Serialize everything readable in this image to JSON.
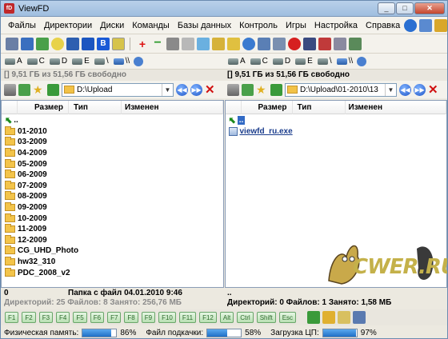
{
  "window": {
    "title": "ViewFD",
    "app_icon_text": "fD"
  },
  "menu": [
    "Файлы",
    "Директории",
    "Диски",
    "Команды",
    "Базы данных",
    "Контроль",
    "Игры",
    "Настройка",
    "Справка"
  ],
  "drives": {
    "left": [
      {
        "label": "A",
        "net": false
      },
      {
        "label": "C",
        "net": false
      },
      {
        "label": "D",
        "net": false
      },
      {
        "label": "E",
        "net": false
      },
      {
        "label": "\\",
        "net": false
      },
      {
        "label": "\\\\",
        "net": true
      }
    ],
    "right": [
      {
        "label": "A",
        "net": false
      },
      {
        "label": "C",
        "net": false
      },
      {
        "label": "D",
        "net": false
      },
      {
        "label": "E",
        "net": false
      },
      {
        "label": "\\",
        "net": false
      },
      {
        "label": "\\\\",
        "net": true
      }
    ]
  },
  "left_panel": {
    "free_space": "[] 9,51 ГБ из 51,56 ГБ свободно",
    "path": "D:\\Upload",
    "columns": {
      "size": "Размер",
      "type": "Тип",
      "modified": "Изменен"
    },
    "up_label": "..",
    "folders": [
      "01-2010",
      "03-2009",
      "04-2009",
      "05-2009",
      "06-2009",
      "07-2009",
      "08-2009",
      "09-2009",
      "10-2009",
      "11-2009",
      "12-2009",
      "CG_UHD_Photo",
      "hw32_310",
      "PDC_2008_v2"
    ],
    "status_left": "0",
    "status_info": "Папка с файл  04.01.2010 9:46",
    "status_summary": "Директорий: 25   Файлов: 8   Занято: 256,76 МБ"
  },
  "right_panel": {
    "free_space": "[] 9,51 ГБ из 51,56 ГБ свободно",
    "path": "D:\\Upload\\01-2010\\13",
    "columns": {
      "size": "Размер",
      "type": "Тип",
      "modified": "Изменен"
    },
    "up_label": "..",
    "file": "viewfd_ru.exe",
    "status_left": "..",
    "status_summary": "Директорий: 0   Файлов: 1   Занято: 1,58 МБ"
  },
  "fkeys": [
    "F1",
    "F2",
    "F3",
    "F4",
    "F5",
    "F6",
    "F7",
    "F8",
    "F9",
    "F10",
    "F11",
    "F12",
    "Alt",
    "Ctrl",
    "Shift",
    "Esc"
  ],
  "meters": [
    {
      "label": "Физическая память:",
      "value": "86%",
      "fraction": 0.86
    },
    {
      "label": "Файл подкачки:",
      "value": "58%",
      "fraction": 0.58
    },
    {
      "label": "Загрузка ЦП:",
      "value": "97%",
      "fraction": 0.97
    }
  ],
  "watermark": {
    "text": "CWER.RU"
  },
  "colors": {
    "selection": "#316ac5",
    "accent_green": "#2e6b2e",
    "meter": "#1f6fc6"
  }
}
